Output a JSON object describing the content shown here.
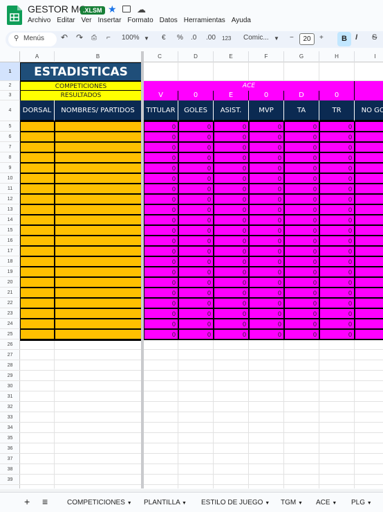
{
  "app": {
    "title": "GESTOR MG",
    "badge": "XLSM"
  },
  "menu": [
    "Archivo",
    "Editar",
    "Ver",
    "Insertar",
    "Formato",
    "Datos",
    "Herramientas",
    "Ayuda"
  ],
  "toolbar": {
    "search_label": "Menús",
    "zoom": "100%",
    "currency": "€",
    "percent": "%",
    "dec_decrease": ".0",
    "dec_increase": ".00",
    "number_format": "123",
    "font": "Comic...",
    "font_size": "20",
    "minus": "−",
    "plus": "+",
    "bold": "B",
    "italic": "I",
    "strike": "S"
  },
  "columns": [
    "A",
    "B",
    "C",
    "D",
    "E",
    "F",
    "G",
    "H",
    "I"
  ],
  "rows": [
    "1",
    "2",
    "3",
    "4",
    "5",
    "6",
    "7",
    "8",
    "9",
    "10",
    "11",
    "12",
    "13",
    "14",
    "15",
    "16",
    "17",
    "18",
    "19",
    "20",
    "21",
    "22",
    "23",
    "24",
    "25",
    "26",
    "27",
    "28",
    "29",
    "30",
    "31",
    "32",
    "33",
    "34",
    "35",
    "36",
    "37",
    "38",
    "39"
  ],
  "sheet": {
    "title": "ESTADISTICAS",
    "competiciones": "COMPETICIONES",
    "resultados": "RESULTADOS",
    "ace": "ACE",
    "result_codes": [
      "V",
      "0",
      "E",
      "0",
      "D",
      "0"
    ],
    "headers": [
      "DORSAL",
      "NOMBRES/ PARTIDOS",
      "TITULAR",
      "GOLES",
      "ASIST.",
      "MVP",
      "TA",
      "TR",
      "NO GOL"
    ],
    "cell_value": "0"
  },
  "tabs": {
    "add": "+",
    "list": "≡",
    "items": [
      "COMPETICIONES",
      "PLANTILLA",
      "ESTILO DE JUEGO",
      "TGM",
      "ACE",
      "PLG"
    ]
  },
  "colors": {
    "title_bg": "#1f4e79",
    "yellow": "#ffff00",
    "navy": "#0b2a52",
    "magenta": "#ff00ff",
    "orange": "#ffc000"
  }
}
